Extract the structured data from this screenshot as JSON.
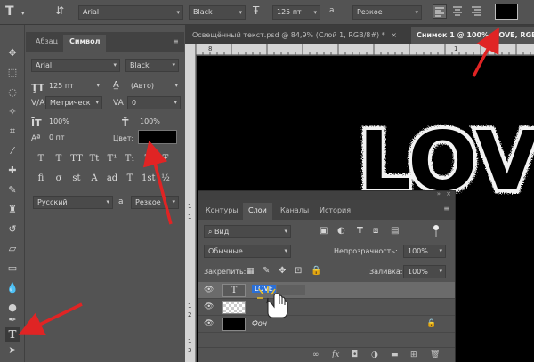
{
  "options_bar": {
    "tool_icon": "T",
    "font_family": "Arial",
    "font_style": "Black",
    "font_size": "125 пт",
    "aa_label": "a",
    "antialias": "Резкое",
    "text_color": "#000000"
  },
  "char_panel": {
    "tabs": [
      "Абзац",
      "Символ"
    ],
    "active_tab": "Символ",
    "font_family": "Arial",
    "font_style": "Black",
    "font_size": "125 пт",
    "leading": "(Авто)",
    "kerning": "Метрическ",
    "tracking": "0",
    "vertical_scale": "100%",
    "horizontal_scale": "100%",
    "baseline_shift": "0 пт",
    "color_label": "Цвет:",
    "color": "#000000",
    "glyph_buttons": [
      "T",
      "T",
      "TT",
      "Tt",
      "T¹",
      "T₁",
      "T",
      "Ŧ"
    ],
    "glyph_buttons2": [
      "fi",
      "σ",
      "st",
      "A",
      "ad",
      "T",
      "1st",
      "½"
    ],
    "language": "Русский",
    "aa_label": "a",
    "antialias": "Резкое"
  },
  "document_tabs": [
    {
      "label": "Освещённый текст.psd @ 84,9% (Слой 1, RGB/8#) *",
      "closable": "×",
      "active": false
    },
    {
      "label": "Снимок 1 @ 100% (LOVE, RGB",
      "active": true
    }
  ],
  "ruler_h_numbers": [
    "8",
    "1"
  ],
  "ruler_v_numbers": [
    "1",
    "1",
    "1",
    "2",
    "1",
    "3"
  ],
  "canvas_text": "LOVE",
  "layers_panel": {
    "tabs": [
      "Контуры",
      "Слои",
      "Каналы",
      "История"
    ],
    "active_tab": "Слои",
    "filter_label": "Вид",
    "blend_mode": "Обычные",
    "opacity_label": "Непрозрачность:",
    "opacity": "100%",
    "lock_label": "Закрепить:",
    "fill_label": "Заливка:",
    "fill": "100%",
    "layers": [
      {
        "name": "LOVE",
        "type": "text",
        "selected": true
      },
      {
        "name": "",
        "type": "transparent",
        "selected": false
      },
      {
        "name": "Фон",
        "type": "background",
        "selected": false
      }
    ],
    "bottom_icons": [
      "link-icon",
      "fx-icon",
      "mask-icon",
      "adjustment-icon",
      "folder-icon",
      "new-layer-icon",
      "trash-icon"
    ]
  },
  "colors": {
    "panel_bg": "#535353",
    "arrow_red": "#e02424",
    "selection_blue": "#2b6fd6"
  }
}
